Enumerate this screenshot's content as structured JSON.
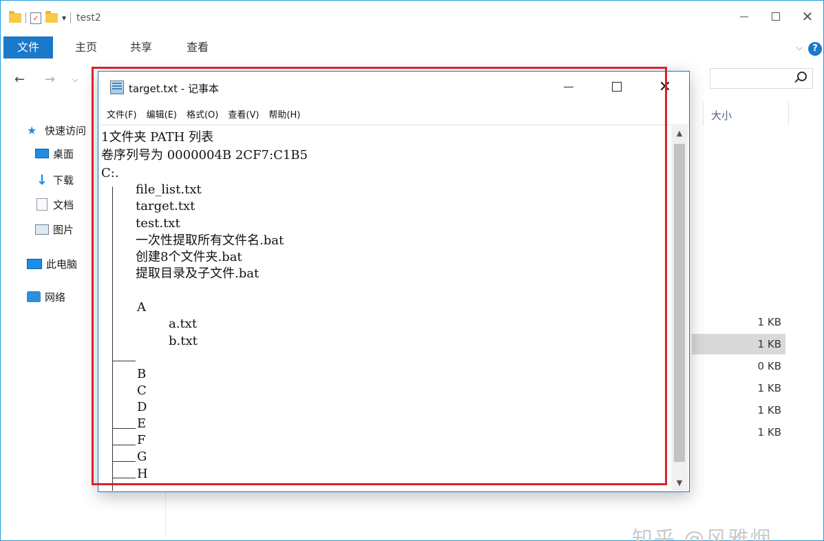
{
  "explorer": {
    "title": "test2",
    "ribbon_tabs": [
      "文件",
      "主页",
      "共享",
      "查看"
    ],
    "nav_items": [
      "快速访问",
      "桌面",
      "下载",
      "文档",
      "图片",
      "此电脑",
      "网络"
    ],
    "column_header": "大小",
    "file_sizes": [
      "1 KB",
      "1 KB",
      "0 KB",
      "1 KB",
      "1 KB",
      "1 KB"
    ],
    "selected_row": 1,
    "help_label": "?"
  },
  "notepad": {
    "title": "target.txt - 记事本",
    "menus": [
      "文件(F)",
      "编辑(E)",
      "格式(O)",
      "查看(V)",
      "帮助(H)"
    ],
    "lines": [
      "1文件夹 PATH 列表",
      "卷序列号为 0000004B 2CF7:C1B5",
      "C:.",
      "file_list.txt",
      "target.txt",
      "test.txt",
      "一次性提取所有文件名.bat",
      "创建8个文件夹.bat",
      "提取目录及子文件.bat",
      "A",
      "a.txt",
      "b.txt",
      "B",
      "C",
      "D",
      "E",
      "F",
      "G",
      "H"
    ]
  },
  "watermark": "知乎 @风雅烟",
  "colors": {
    "accent": "#1979ca",
    "highlight_border": "#d9202a",
    "selected_row": "#d9d9d9"
  }
}
